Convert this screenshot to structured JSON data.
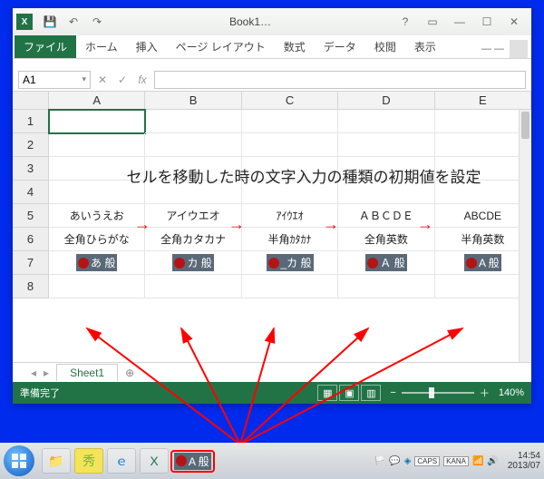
{
  "title": "Book1…",
  "ribbon": {
    "file": "ファイル",
    "tabs": [
      "ホーム",
      "挿入",
      "ページ レイアウト",
      "数式",
      "データ",
      "校閲",
      "表示"
    ]
  },
  "namebox": "A1",
  "columns": [
    "A",
    "B",
    "C",
    "D",
    "E"
  ],
  "rows": [
    "1",
    "2",
    "3",
    "4",
    "5",
    "6",
    "7",
    "8"
  ],
  "heading": "セルを移動した時の文字入力の種類の初期値を設定",
  "row5": [
    "あいうえお",
    "アイウエオ",
    "ｱｲｳｴｵ",
    "ＡＢＣＤＥ",
    "ABCDE"
  ],
  "row6": [
    "全角ひらがな",
    "全角カタカナ",
    "半角ｶﾀｶﾅ",
    "全角英数",
    "半角英数"
  ],
  "ime_badges": [
    "あ 般",
    "カ 般",
    "_カ 般",
    "Ａ 般",
    "A 般"
  ],
  "sheet_tab": "Sheet1",
  "status": "準備完了",
  "zoom": "140%",
  "taskbar_ime": "A 般",
  "caps": "CAPS",
  "kana": "KANA",
  "clock_time": "14:54",
  "clock_date": "2013/07"
}
